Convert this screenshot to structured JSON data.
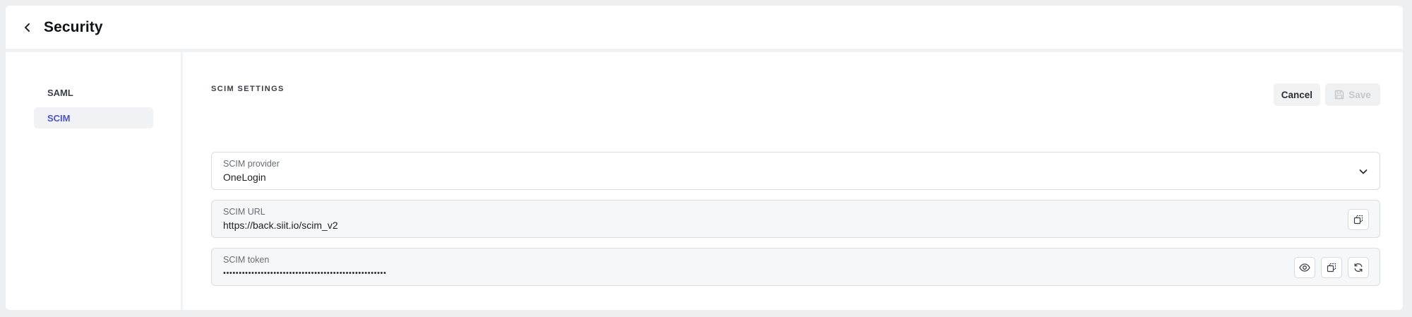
{
  "header": {
    "title": "Security",
    "back_icon": "chevron-left-icon"
  },
  "sidebar": {
    "items": [
      {
        "label": "SAML",
        "active": false
      },
      {
        "label": "SCIM",
        "active": true
      }
    ]
  },
  "main": {
    "section_title": "SCIM SETTINGS",
    "actions": {
      "cancel_label": "Cancel",
      "save_label": "Save",
      "save_icon": "save-icon"
    },
    "fields": {
      "provider": {
        "label": "SCIM provider",
        "value": "OneLogin",
        "icon": "chevron-down-icon"
      },
      "url": {
        "label": "SCIM URL",
        "value": "https://back.siit.io/scim_v2",
        "icon": "copy-icon"
      },
      "token": {
        "label": "SCIM token",
        "value": "••••••••••••••••••••••••••••••••••••••••••••••••••••",
        "icons": [
          "eye-icon",
          "copy-icon",
          "refresh-icon"
        ]
      }
    }
  },
  "colors": {
    "accent": "#4a55c2",
    "border": "#d9dce1",
    "muted_text": "#686d76"
  }
}
